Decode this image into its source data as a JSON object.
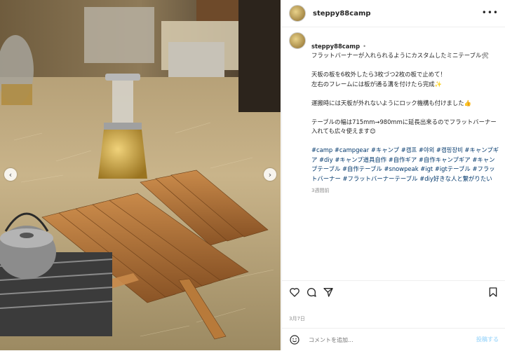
{
  "post": {
    "username": "steppy88camp",
    "more_icon": "more-horizontal-icon",
    "avatar_icon": "avatar-image"
  },
  "photo": {
    "alt": "ウッドテーブルとバーナー",
    "next_icon": "chevron-right-icon",
    "prev_icon": "chevron-left-icon"
  },
  "caption": {
    "separator": "•",
    "line1": "フラットバーナーが入れられるようにカスタムしたミニテーブル🛠",
    "para2": "天板の板を6枚外したら3枚づつ2枚の板で止めて！\n左右のフレームには板が通る溝を付けたら完成✨",
    "para3": "運搬時には天板が外れないようにロック機構も付けました👍",
    "para4": "テーブルの幅は715mm→980mmに延長出来るのでフラットバーナー入れても広々使えます😊",
    "hashtags": "#camp #campgear #キャンプ #캠프 #야외 #캠핑장비 #キャンプギア #diy #キャンプ道具自作 #自作ギア #自作キャンプギア #キャンプテーブル #自作テーブル #snowpeak #igt #igtテーブル #フラットバーナー #フラットバーナーテーブル #diy好きな人と繋がりたい",
    "time": "3週間前"
  },
  "actions": {
    "like_icon": "heart-icon",
    "comment_icon": "comment-icon",
    "share_icon": "share-icon",
    "save_icon": "bookmark-icon"
  },
  "date": "3月7日",
  "comment_input": {
    "emoji_icon": "smile-icon",
    "placeholder": "コメントを追加...",
    "post_label": "投稿する"
  }
}
